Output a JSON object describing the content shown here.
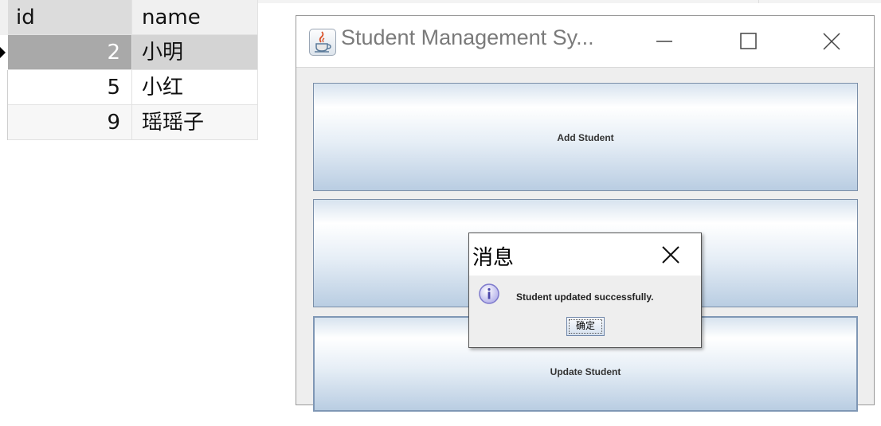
{
  "grid": {
    "columns": {
      "id": "id",
      "name": "name"
    },
    "rows": [
      {
        "id": "2",
        "name": "小明"
      },
      {
        "id": "5",
        "name": "小红"
      },
      {
        "id": "9",
        "name": "瑶瑶子"
      }
    ]
  },
  "window": {
    "title": "Student Management Sy...",
    "buttons": {
      "add": "Add Student",
      "middle": "",
      "update": "Update Student"
    }
  },
  "dialog": {
    "title": "消息",
    "message": "Student updated successfully.",
    "ok_label": "确定"
  },
  "colors": {
    "selected_row": "#d4d4d4",
    "selected_id_cell": "#a9a9a9",
    "button_gradient_bottom": "#b9cde2",
    "info_icon": "#8a86d6"
  }
}
